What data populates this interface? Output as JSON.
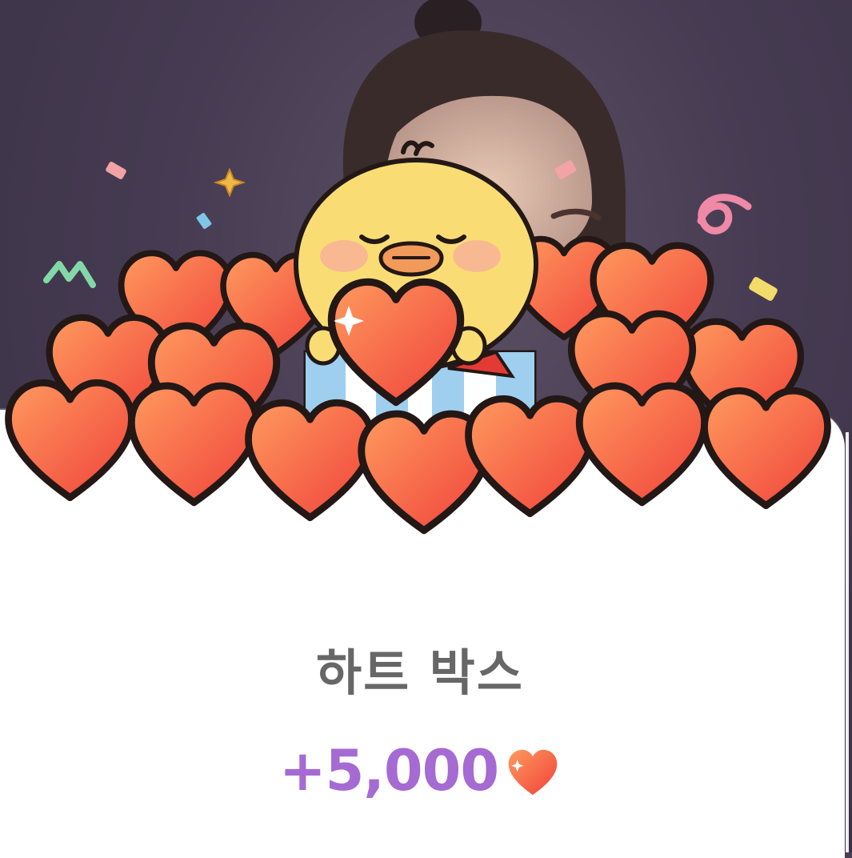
{
  "reward": {
    "title": "하트 박스",
    "amount": "+5,000",
    "currency_icon": "heart-icon"
  },
  "icons": {
    "mascot": "chick-mascot",
    "gift_box": "gift-box-icon",
    "decorations": "confetti"
  },
  "colors": {
    "heart_top": "#ff8d5a",
    "heart_bottom": "#f0473a",
    "amount_text": "#a66ad3",
    "title_text": "#676767",
    "mascot": "#f9dd74"
  }
}
